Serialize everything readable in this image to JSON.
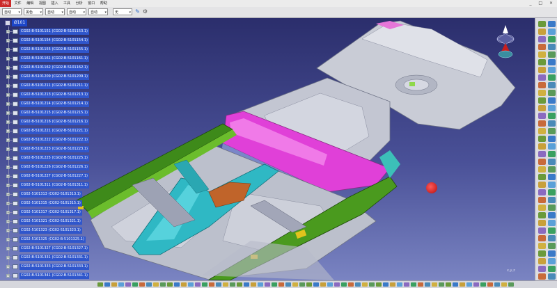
{
  "menubar": {
    "items": [
      "开始",
      "文件",
      "编辑",
      "视图",
      "插入",
      "工具",
      "分析",
      "窗口",
      "帮助"
    ],
    "window_controls": "_ □ ×"
  },
  "toolbar": {
    "selects": [
      "自动",
      "黑色",
      "自动",
      "自动",
      "自动",
      "无"
    ]
  },
  "tree": {
    "root": "Ø101",
    "items": [
      "CG02-B-5101151 (CG02-B-5101153.1)",
      "CG02-B-5101154 (CG02-B-5101154.1)",
      "CG02-B-5101155 (CG02-B-5101155.1)",
      "CG02-B-5101161 (CG02-B-5101161.1)",
      "CG02-B-5101162 (CG02-B-5101162.1)",
      "CG02-B-5101209 (CG02-B-5101209.1)",
      "CG02-B-5101211 (CG02-B-5101211.1)",
      "CG02-B-5101213 (CG02-B-5101213.1)",
      "CG02-B-5101214 (CG02-B-5101214.1)",
      "CG02-B-5101215 (CG02-B-5101215.1)",
      "CG02-B-5101216 (CG02-B-5101216.1)",
      "CG02-B-5101221 (CG02-B-5101221.1)",
      "CG02-B-5101222 (CG02-B-5101222.1)",
      "CG02-B-5101223 (CG02-B-5101223.1)",
      "CG02-B-5101225 (CG02-B-5101225.1)",
      "CG02-B-5101226 (CG02-B-5101226.1)",
      "CG02-B-5101227 (CG02-B-5101227.1)",
      "CG02-B-5101311 (CG02-B-5101311.1)",
      "CG02-5101313 (CG02-5101313.1)",
      "CG02-5101315 (CG02-5101315.1)",
      "CG02-5101317 (CG02-5101317.1)",
      "CG02-5101321 (CG02-5101321.1)",
      "CG02-5101323 (CG02-5101323.1)",
      "CG02-5101325 (CG02-B-5101325.1)",
      "CG02-B-5101327 (CG02-B-5101327.1)",
      "CG02-B-5101331 (CG02-B-5101331.1)",
      "CG02-B-5101333 (CG02-B-5101333.1)",
      "CG02-B-5101341 (CG02-B-5101341.1)"
    ]
  },
  "viewport": {
    "axis_label": "x,y,z"
  },
  "colors": {
    "background_top": "#2b2e6c",
    "background_bottom": "#7a84c2",
    "panel_gray": "#b9bcc8",
    "sill_green": "#3e8a1a",
    "crossmember_magenta": "#e040d8",
    "tunnel_teal": "#2fb8c4",
    "bracket_orange": "#c0642a",
    "selection_blue": "#2f56cc",
    "active_menu_red": "#cc2a2a"
  }
}
